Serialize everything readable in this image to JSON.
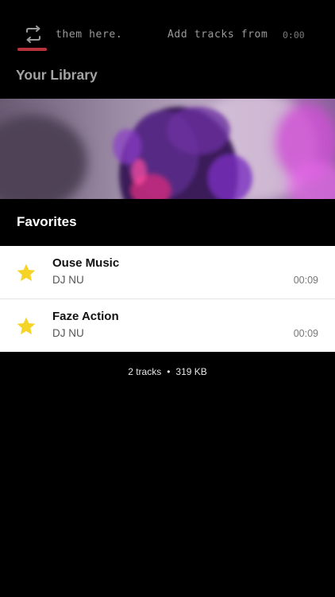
{
  "player": {
    "marquee_left": "them here.",
    "marquee_right": "Add tracks from",
    "time": "0:00",
    "repeat_icon": "repeat-icon",
    "accent_color": "#b8323c"
  },
  "library": {
    "title": "Your Library"
  },
  "playlist": {
    "title": "Favorites",
    "tracks": [
      {
        "title": "Ouse Music",
        "artist": "DJ NU",
        "duration": "00:09",
        "icon": "star-icon"
      },
      {
        "title": "Faze Action",
        "artist": "DJ NU",
        "duration": "00:09",
        "icon": "star-icon"
      }
    ],
    "summary": {
      "count": "2 tracks",
      "separator": "•",
      "size": "319 KB"
    }
  },
  "colors": {
    "background": "#000000",
    "star": "#f5d327",
    "list_background": "#ffffff"
  }
}
